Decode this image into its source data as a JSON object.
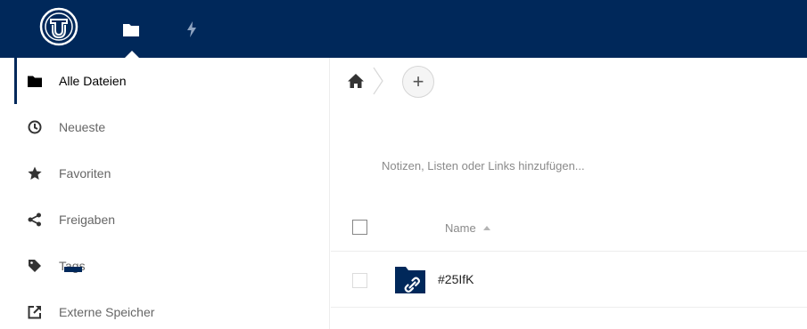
{
  "header": {
    "logo_icon": "tu-logo-icon",
    "apps": [
      {
        "icon": "folder-icon",
        "active": true
      },
      {
        "icon": "lightning-icon",
        "active": false
      }
    ],
    "colors": {
      "background": "#00285a",
      "foreground": "#ffffff"
    }
  },
  "sidebar": {
    "items": [
      {
        "label": "Alle Dateien",
        "icon": "folder-icon",
        "active": true
      },
      {
        "label": "Neueste",
        "icon": "clock-icon"
      },
      {
        "label": "Favoriten",
        "icon": "star-icon"
      },
      {
        "label": "Freigaben",
        "icon": "share-icon"
      },
      {
        "label": "Tags",
        "icon": "tag-icon"
      },
      {
        "label": "Externe Speicher",
        "icon": "external-link-icon"
      }
    ]
  },
  "main": {
    "breadcrumb": {
      "home_icon": "home-icon",
      "add_label": "+"
    },
    "notes_placeholder": "Notizen, Listen oder Links hinzufügen...",
    "table": {
      "name_header": "Name",
      "sort": "ascending",
      "rows": [
        {
          "name": "#25IfK",
          "icon": "shared-link-folder-icon"
        }
      ]
    }
  }
}
